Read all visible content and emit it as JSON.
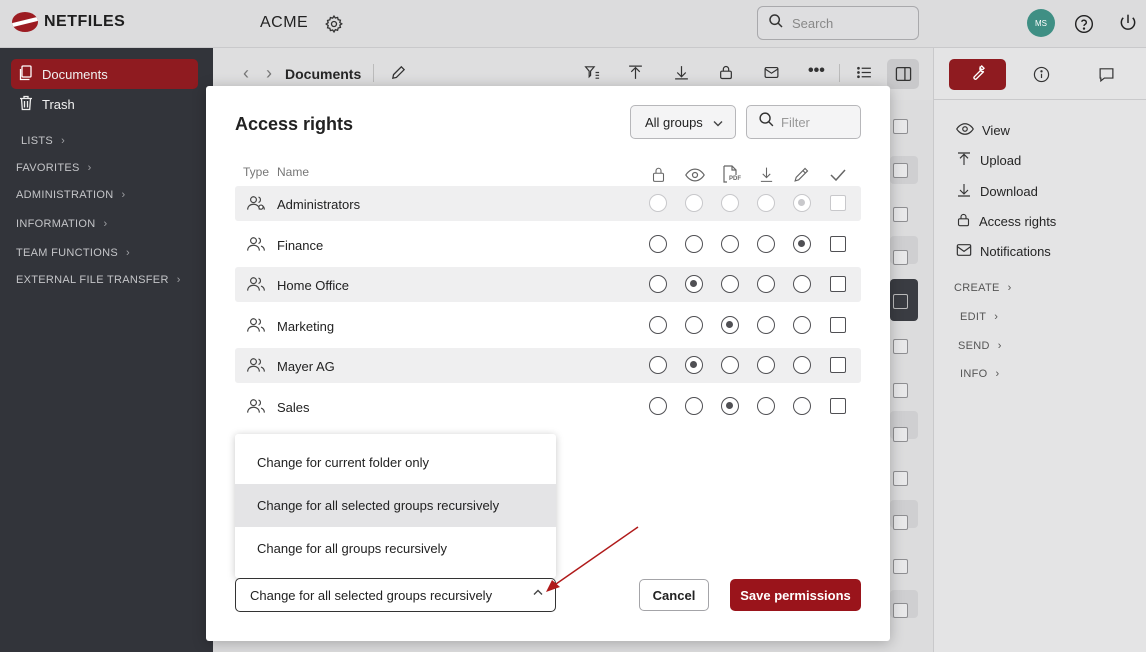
{
  "app": {
    "logo_text": "NETFILES",
    "tenant": "ACME",
    "avatar_initials": "MS"
  },
  "search": {
    "placeholder": "Search"
  },
  "sidebar": {
    "items": [
      {
        "label": "Documents",
        "icon": "documents-icon",
        "active": true
      },
      {
        "label": "Trash",
        "icon": "trash-icon",
        "active": false
      }
    ],
    "sections": [
      "LISTS",
      "FAVORITES",
      "ADMINISTRATION",
      "INFORMATION",
      "TEAM FUNCTIONS",
      "EXTERNAL FILE TRANSFER"
    ]
  },
  "toolbar": {
    "title": "Documents"
  },
  "right_panel": {
    "actions": [
      "View",
      "Upload",
      "Download",
      "Access rights",
      "Notifications"
    ],
    "sections": [
      "CREATE",
      "EDIT",
      "SEND",
      "INFO"
    ]
  },
  "dialog": {
    "title": "Access rights",
    "group_filter": "All groups",
    "filter_placeholder": "Filter",
    "col_type": "Type",
    "col_name": "Name",
    "pdf_label": "PDF",
    "permission_columns": [
      "lock-icon",
      "eye-icon",
      "pdf-icon",
      "download-icon",
      "edit-icon",
      "check-icon"
    ],
    "groups": [
      {
        "name": "Administrators",
        "selected_level": 4,
        "disabled": true
      },
      {
        "name": "Finance",
        "selected_level": 4,
        "disabled": false
      },
      {
        "name": "Home Office",
        "selected_level": 1,
        "disabled": false
      },
      {
        "name": "Marketing",
        "selected_level": 2,
        "disabled": false
      },
      {
        "name": "Mayer AG",
        "selected_level": 1,
        "disabled": false
      },
      {
        "name": "Sales",
        "selected_level": 2,
        "disabled": false
      }
    ],
    "scope_options": [
      "Change for current folder only",
      "Change for all selected groups recursively",
      "Change for all groups recursively"
    ],
    "scope_selected": "Change for all selected groups recursively",
    "cancel_label": "Cancel",
    "save_label": "Save permissions"
  },
  "colors": {
    "brand": "#9a141b",
    "annotation_arrow": "#b01a1a"
  }
}
